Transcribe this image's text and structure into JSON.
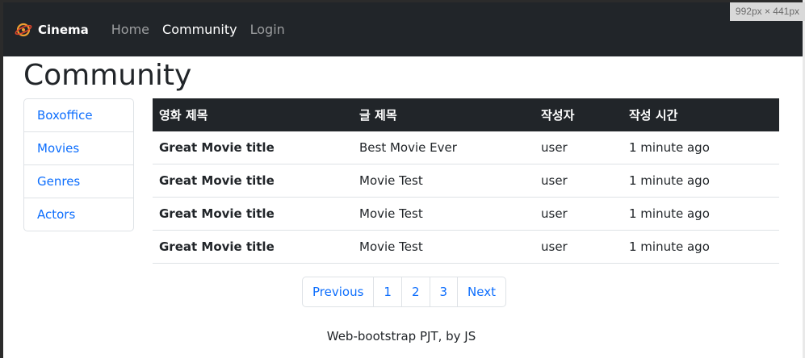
{
  "navbar": {
    "brand": "Cinema",
    "links": [
      {
        "label": "Home",
        "active": false
      },
      {
        "label": "Community",
        "active": true
      },
      {
        "label": "Login",
        "active": false
      }
    ]
  },
  "viewport_indicator": "992px × 441px",
  "page_title": "Community",
  "sidebar": {
    "items": [
      {
        "label": "Boxoffice"
      },
      {
        "label": "Movies"
      },
      {
        "label": "Genres"
      },
      {
        "label": "Actors"
      }
    ]
  },
  "table": {
    "headers": [
      "영화 제목",
      "글 제목",
      "작성자",
      "작성 시간"
    ],
    "rows": [
      {
        "movie": "Great Movie title",
        "title": "Best Movie Ever",
        "author": "user",
        "time": "1 minute ago"
      },
      {
        "movie": "Great Movie title",
        "title": "Movie Test",
        "author": "user",
        "time": "1 minute ago"
      },
      {
        "movie": "Great Movie title",
        "title": "Movie Test",
        "author": "user",
        "time": "1 minute ago"
      },
      {
        "movie": "Great Movie title",
        "title": "Movie Test",
        "author": "user",
        "time": "1 minute ago"
      }
    ]
  },
  "pagination": {
    "previous": "Previous",
    "pages": [
      "1",
      "2",
      "3"
    ],
    "next": "Next"
  },
  "footer": "Web-bootstrap PJT, by JS",
  "colors": {
    "navbar_bg": "#212529",
    "link": "#0d6efd",
    "logo": "#f0a030"
  }
}
